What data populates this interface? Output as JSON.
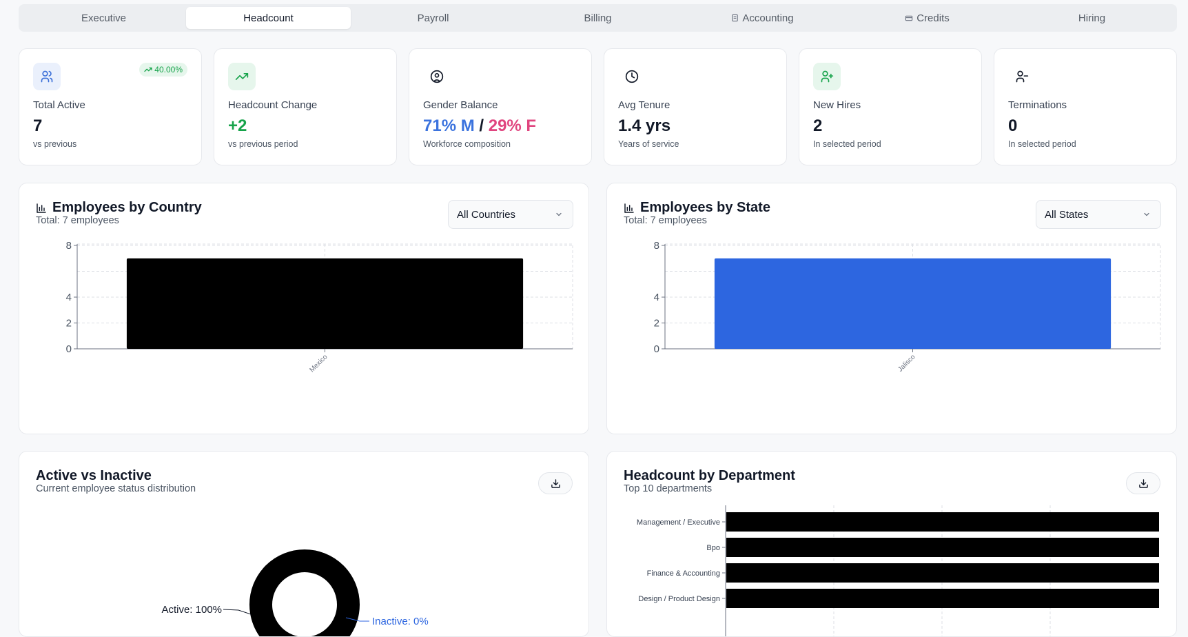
{
  "tabs": [
    {
      "label": "Executive",
      "icon": ""
    },
    {
      "label": "Headcount",
      "icon": ""
    },
    {
      "label": "Payroll",
      "icon": ""
    },
    {
      "label": "Billing",
      "icon": ""
    },
    {
      "label": "Accounting",
      "icon": "document-icon"
    },
    {
      "label": "Credits",
      "icon": "credit-card-icon"
    },
    {
      "label": "Hiring",
      "icon": ""
    }
  ],
  "active_tab": "Headcount",
  "kpis": {
    "total_active": {
      "label": "Total Active",
      "value": "7",
      "sub": "vs previous",
      "badge": "40.00%",
      "icon": "users-icon"
    },
    "headcount_change": {
      "label": "Headcount Change",
      "value": "+2",
      "sub": "vs previous period",
      "icon": "trending-up-icon"
    },
    "gender_balance": {
      "label": "Gender Balance",
      "male": "71% M",
      "separator": "/",
      "female": "29% F",
      "sub": "Workforce composition",
      "icon": "user-circle-icon"
    },
    "avg_tenure": {
      "label": "Avg Tenure",
      "value": "1.4 yrs",
      "sub": "Years of service",
      "icon": "clock-icon"
    },
    "new_hires": {
      "label": "New Hires",
      "value": "2",
      "sub": "In selected period",
      "icon": "user-plus-icon"
    },
    "terminations": {
      "label": "Terminations",
      "value": "0",
      "sub": "In selected period",
      "icon": "user-minus-icon"
    }
  },
  "colors": {
    "accent_blue": "#2d66e0",
    "male_blue": "#3b73de",
    "female_pink": "#e0457f",
    "positive_green": "#16a34a",
    "bar_black": "#000000"
  },
  "country_panel": {
    "title": "Employees by Country",
    "subtitle": "Total: 7 employees",
    "select_value": "All Countries"
  },
  "state_panel": {
    "title": "Employees by State",
    "subtitle": "Total: 7 employees",
    "select_value": "All States"
  },
  "status_panel": {
    "title": "Active vs Inactive",
    "subtitle": "Current employee status distribution"
  },
  "department_panel": {
    "title": "Headcount by Department",
    "subtitle": "Top 10 departments"
  },
  "chart_data": [
    {
      "type": "bar",
      "categories": [
        "Mexico"
      ],
      "values": [
        7
      ],
      "ylim": [
        0,
        8
      ],
      "yticks": [
        0,
        2,
        4,
        8
      ],
      "grid": true,
      "color": "#000000"
    },
    {
      "type": "bar",
      "categories": [
        "Jalisco"
      ],
      "values": [
        7
      ],
      "ylim": [
        0,
        8
      ],
      "yticks": [
        0,
        2,
        4,
        8
      ],
      "grid": true,
      "color": "#2d66e0"
    },
    {
      "type": "pie",
      "categories": [
        "Active",
        "Inactive"
      ],
      "values": [
        100,
        0
      ],
      "labels": [
        "Active: 100%",
        "Inactive: 0%"
      ]
    },
    {
      "type": "bar",
      "orientation": "horizontal",
      "categories": [
        "Management / Executive",
        "Bpo",
        "Finance & Accounting",
        "Design / Product Design"
      ],
      "values": [
        1,
        1,
        1,
        1
      ],
      "grid": true,
      "color": "#000000"
    }
  ]
}
